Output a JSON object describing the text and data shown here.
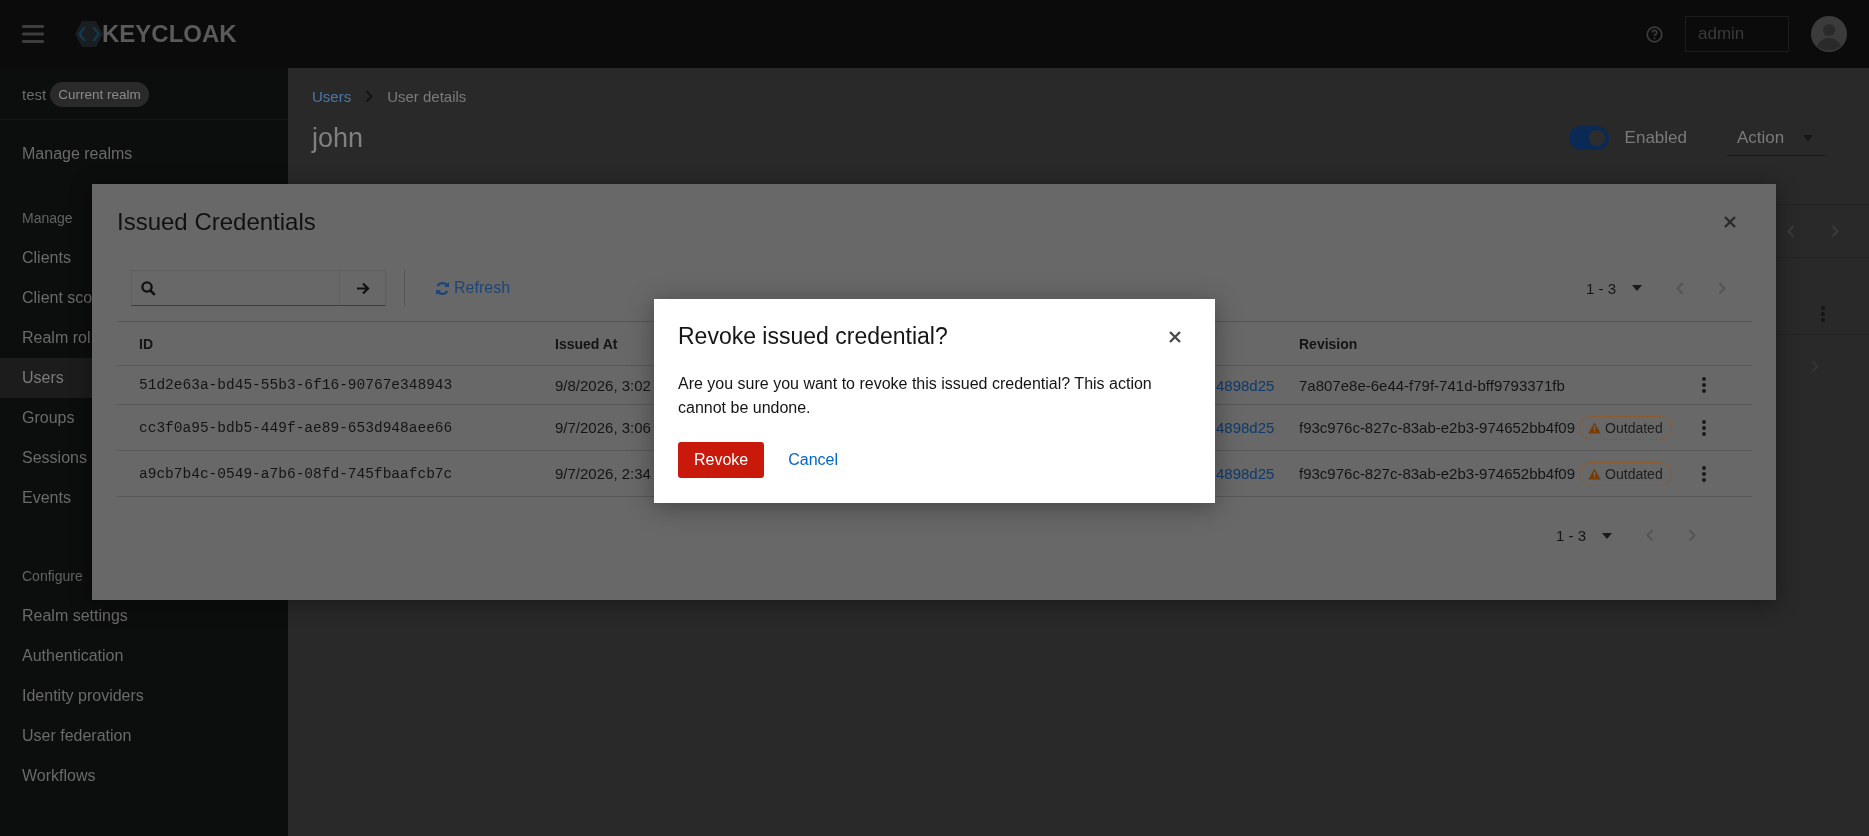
{
  "masthead": {
    "brand": "KEYCLOAK",
    "user": "admin"
  },
  "sidebar": {
    "realm": "test",
    "realm_badge": "Current realm",
    "manage_realms": "Manage realms",
    "sections": [
      {
        "title": "Manage",
        "items": [
          {
            "label": "Clients",
            "selected": false
          },
          {
            "label": "Client sco",
            "selected": false
          },
          {
            "label": "Realm rol",
            "selected": false
          },
          {
            "label": "Users",
            "selected": true
          },
          {
            "label": "Groups",
            "selected": false
          },
          {
            "label": "Sessions",
            "selected": false
          },
          {
            "label": "Events",
            "selected": false
          }
        ]
      },
      {
        "title": "Configure",
        "items": [
          {
            "label": "Realm settings",
            "selected": false
          },
          {
            "label": "Authentication",
            "selected": false
          },
          {
            "label": "Identity providers",
            "selected": false
          },
          {
            "label": "User federation",
            "selected": false
          },
          {
            "label": "Workflows",
            "selected": false
          }
        ]
      }
    ]
  },
  "page": {
    "breadcrumb": [
      {
        "label": "Users",
        "kind": "link"
      },
      {
        "label": "User details",
        "kind": "current"
      }
    ],
    "title": "john",
    "enabled_toggle": {
      "label": "Enabled",
      "on": true
    },
    "action_menu": "Action"
  },
  "credentials_modal": {
    "title": "Issued Credentials",
    "refresh": "Refresh",
    "pagination_top": "1 - 3",
    "columns": [
      "ID",
      "Issued At",
      "Revision"
    ],
    "rows": [
      {
        "id": "51d2e63a-bd45-55b3-6f16-90767e348943",
        "issued_at": "9/8/2026, 3:02",
        "link": "4898d25",
        "revision": "7a807e8e-6e44-f79f-741d-bff9793371fb",
        "outdated": false
      },
      {
        "id": "cc3f0a95-bdb5-449f-ae89-653d948aee66",
        "issued_at": "9/7/2026, 3:06",
        "link": "4898d25",
        "revision": "f93c976c-827c-83ab-e2b3-974652bb4f09",
        "outdated": true,
        "badge": "Outdated"
      },
      {
        "id": "a9cb7b4c-0549-a7b6-08fd-745fbaafcb7c",
        "issued_at": "9/7/2026, 2:34",
        "link": "4898d25",
        "revision": "f93c976c-827c-83ab-e2b3-974652bb4f09",
        "outdated": true,
        "badge": "Outdated"
      }
    ],
    "pagination_bottom": "1 - 3"
  },
  "confirm_dialog": {
    "title": "Revoke issued credential?",
    "message": "Are you sure you want to revoke this issued credential? This action cannot be undone.",
    "confirm": "Revoke",
    "cancel": "Cancel"
  }
}
